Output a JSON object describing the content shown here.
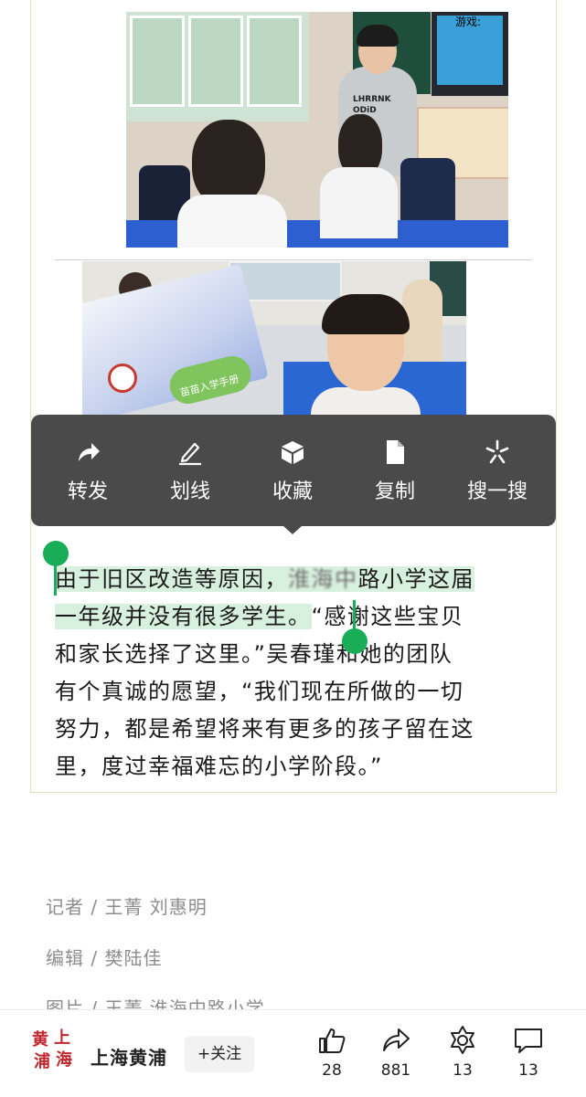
{
  "photo1": {
    "tv_text": "游戏:",
    "shirt_text": "LHRRNK\nODiD"
  },
  "photo2": {
    "book_title": "苗苗入学手册"
  },
  "context_menu": {
    "items": [
      {
        "label": "转发",
        "icon": "forward-icon"
      },
      {
        "label": "划线",
        "icon": "underline-pen-icon"
      },
      {
        "label": "收藏",
        "icon": "favorite-cube-icon"
      },
      {
        "label": "复制",
        "icon": "copy-document-icon"
      },
      {
        "label": "搜一搜",
        "icon": "search-sparkle-icon"
      }
    ]
  },
  "article": {
    "line1_pre": "由于旧区改造等原因，",
    "line1_redacted": "淮海中",
    "line1_post": "路小学这届",
    "line2_selected": "一年级并没有很多学生。",
    "line2_rest": "“感谢这些宝贝",
    "line3": "和家长选择了这里。”吴春瑾和她的团队",
    "line4": "有个真诚的愿望，“我们现在所做的一切",
    "line5": "努力，都是希望将来有更多的孩子留在这",
    "line6": "里，度过幸福难忘的小学阶段。”"
  },
  "credits": {
    "reporter": "记者 / 王菁 刘惠明",
    "editor": "编辑 / 樊陆佳",
    "photo": "图片 / 王菁 淮海中路小学"
  },
  "bottom_bar": {
    "logo_text": [
      "黄",
      "上",
      "浦",
      "海"
    ],
    "account_name": "上海黄浦",
    "follow_label": "+关注",
    "actions": [
      {
        "icon": "thumbs-up-icon",
        "count": "28"
      },
      {
        "icon": "share-icon",
        "count": "881"
      },
      {
        "icon": "wow-icon",
        "count": "13"
      },
      {
        "icon": "comment-icon",
        "count": "13"
      }
    ]
  },
  "colors": {
    "selection_handle": "#1aad57",
    "selection_highlight": "#d8f0de",
    "menu_background": "#4a4a4a",
    "logo_red": "#c4262e"
  }
}
